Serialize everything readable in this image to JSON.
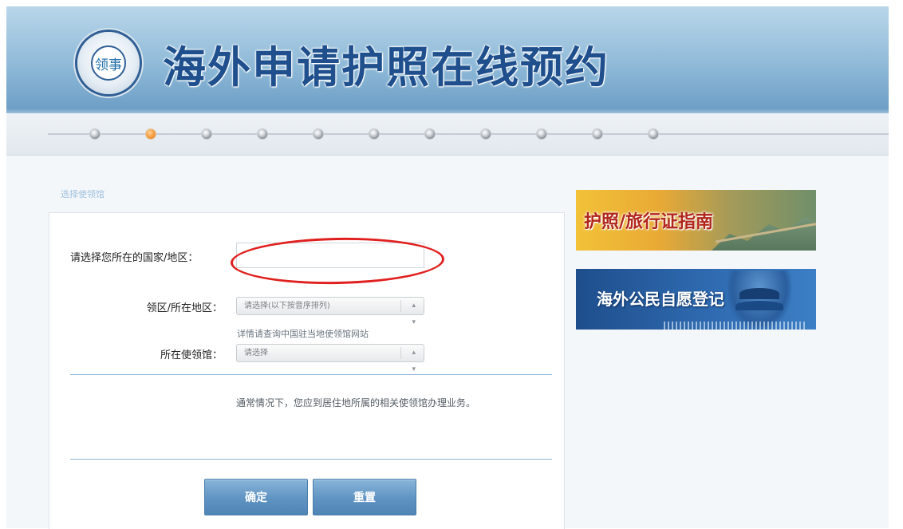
{
  "header": {
    "title": "海外申请护照在线预约",
    "emblem_text": "领事"
  },
  "steps": {
    "count": 11,
    "active_index": 1
  },
  "form": {
    "section_title": "选择使领馆",
    "country_label": "请选择您所在的国家/地区：",
    "country_value": "",
    "region_label": "领区/所在地区：",
    "region_select": "请选择(以下按音序排列)",
    "region_hint": "详情请查询中国驻当地使领馆网站",
    "consulate_label": "所在使领馆：",
    "consulate_select": "请选择",
    "note": "通常情况下，您应到居住地所属的相关使领馆办理业务。",
    "confirm_button": "确定",
    "reset_button": "重置"
  },
  "sidebar": {
    "guide_banner": "护照/旅行证指南",
    "registration_banner": "海外公民自愿登记"
  },
  "colors": {
    "title": "#1f4f8c",
    "active_step": "#f39c3c",
    "button": "#5f93c2",
    "annotation": "#e0201f"
  }
}
